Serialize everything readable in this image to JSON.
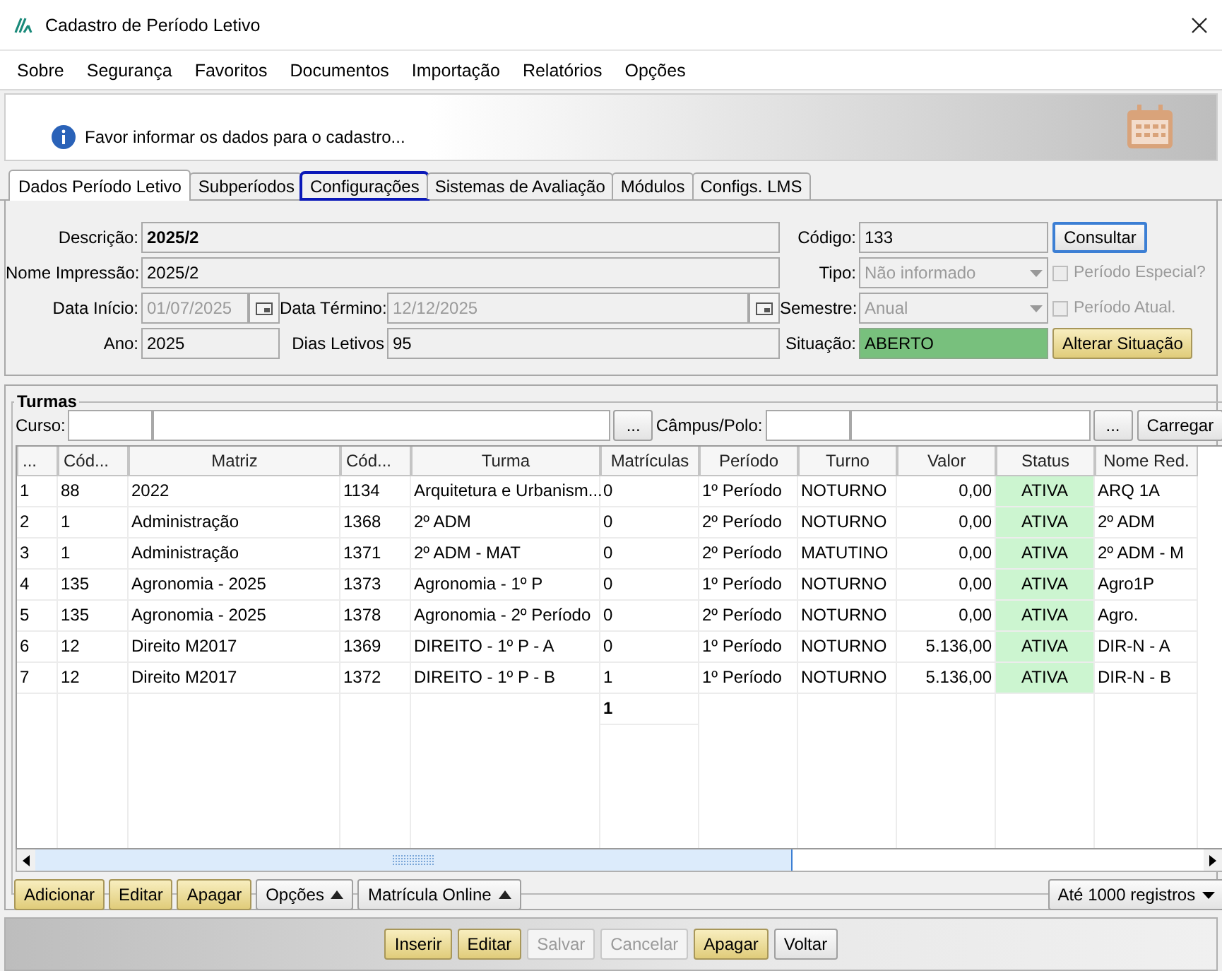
{
  "window": {
    "title": "Cadastro de Período Letivo"
  },
  "menu": [
    "Sobre",
    "Segurança",
    "Favoritos",
    "Documentos",
    "Importação",
    "Relatórios",
    "Opções"
  ],
  "banner": {
    "message": "Favor informar os dados para o cadastro..."
  },
  "tabs": [
    {
      "label": "Dados Período Letivo",
      "selected": true,
      "focused": false
    },
    {
      "label": "Subperíodos",
      "selected": false,
      "focused": false
    },
    {
      "label": "Configurações",
      "selected": false,
      "focused": true
    },
    {
      "label": "Sistemas de Avaliação",
      "selected": false,
      "focused": false
    },
    {
      "label": "Módulos",
      "selected": false,
      "focused": false
    },
    {
      "label": "Configs. LMS",
      "selected": false,
      "focused": false
    }
  ],
  "form": {
    "descricao": {
      "label": "Descrição:",
      "value": "2025/2",
      "disabled": false
    },
    "nome_impressao": {
      "label": "Nome Impressão:",
      "value": "2025/2",
      "disabled": false
    },
    "data_inicio": {
      "label": "Data Início:",
      "value": "01/07/2025",
      "disabled": true
    },
    "data_termino": {
      "label": "Data Término:",
      "value": "12/12/2025",
      "disabled": true
    },
    "ano": {
      "label": "Ano:",
      "value": "2025",
      "disabled": false
    },
    "dias_letivos": {
      "label": "Dias Letivos",
      "value": "95",
      "disabled": false
    },
    "codigo": {
      "label": "Código:",
      "value": "133",
      "disabled": false
    },
    "consultar": {
      "label": "Consultar",
      "kind": "default",
      "disabled": false
    },
    "tipo": {
      "label": "Tipo:",
      "value": "Não informado",
      "disabled": true
    },
    "periodo_especial": {
      "label": "Período Especial?",
      "checked": false,
      "disabled": true
    },
    "semestre": {
      "label": "Semestre:",
      "value": "Anual",
      "disabled": true
    },
    "periodo_atual": {
      "label": "Período Atual.",
      "checked": false,
      "disabled": true
    },
    "situacao": {
      "label": "Situação:",
      "value": "ABERTO"
    },
    "alterar": {
      "label": "Alterar Situação",
      "kind": "yellow",
      "disabled": false
    }
  },
  "turmas": {
    "title": "Turmas",
    "curso_label": "Curso:",
    "curso_button": "...",
    "campus_label": "Câmpus/Polo:",
    "campus_button": "...",
    "load_button": "Carregar",
    "table": {
      "columns": [
        "...",
        "Cód...",
        "Matriz",
        "Cód...",
        "Turma",
        "Matrículas",
        "Período",
        "Turno",
        "Valor",
        "Status",
        "Nome Red."
      ],
      "rows": [
        [
          "1",
          "88",
          "2022",
          "1134",
          "Arquitetura e Urbanism...",
          "0",
          "1º Período",
          "NOTURNO",
          "0,00",
          "ATIVA",
          "ARQ 1A"
        ],
        [
          "2",
          "1",
          "Administração",
          "1368",
          "2º ADM",
          "0",
          "2º Período",
          "NOTURNO",
          "0,00",
          "ATIVA",
          "2º ADM"
        ],
        [
          "3",
          "1",
          "Administração",
          "1371",
          "2º ADM - MAT",
          "0",
          "2º Período",
          "MATUTINO",
          "0,00",
          "ATIVA",
          "2º ADM - M"
        ],
        [
          "4",
          "135",
          "Agronomia - 2025",
          "1373",
          "Agronomia - 1º P",
          "0",
          "1º Período",
          "NOTURNO",
          "0,00",
          "ATIVA",
          "Agro1P"
        ],
        [
          "5",
          "135",
          "Agronomia - 2025",
          "1378",
          "Agronomia - 2º Período",
          "0",
          "2º Período",
          "NOTURNO",
          "0,00",
          "ATIVA",
          "Agro."
        ],
        [
          "6",
          "12",
          "Direito M2017",
          "1369",
          "DIREITO - 1º P - A",
          "0",
          "1º Período",
          "NOTURNO",
          "5.136,00",
          "ATIVA",
          "DIR-N - A"
        ],
        [
          "7",
          "12",
          "Direito M2017",
          "1372",
          "DIREITO - 1º P - B",
          "1",
          "1º Período",
          "NOTURNO",
          "5.136,00",
          "ATIVA",
          "DIR-N - B"
        ]
      ],
      "totals": {
        "matriculas": "1"
      }
    },
    "buttons": [
      {
        "label": "Adicionar",
        "kind": "yellow",
        "menu": false
      },
      {
        "label": "Editar",
        "kind": "yellow",
        "menu": false
      },
      {
        "label": "Apagar",
        "kind": "yellow",
        "menu": false
      },
      {
        "label": "Opções",
        "kind": "plain",
        "menu": true
      },
      {
        "label": "Matrícula Online",
        "kind": "plain",
        "menu": true
      }
    ],
    "records": "Até 1000 registros"
  },
  "footer": {
    "buttons": [
      {
        "label": "Inserir",
        "kind": "yellow",
        "disabled": false
      },
      {
        "label": "Editar",
        "kind": "yellow",
        "disabled": false
      },
      {
        "label": "Salvar",
        "kind": "yellow",
        "disabled": true
      },
      {
        "label": "Cancelar",
        "kind": "yellow",
        "disabled": true
      },
      {
        "label": "Apagar",
        "kind": "yellow",
        "disabled": false
      },
      {
        "label": "Voltar",
        "kind": "plain",
        "disabled": false
      }
    ]
  }
}
